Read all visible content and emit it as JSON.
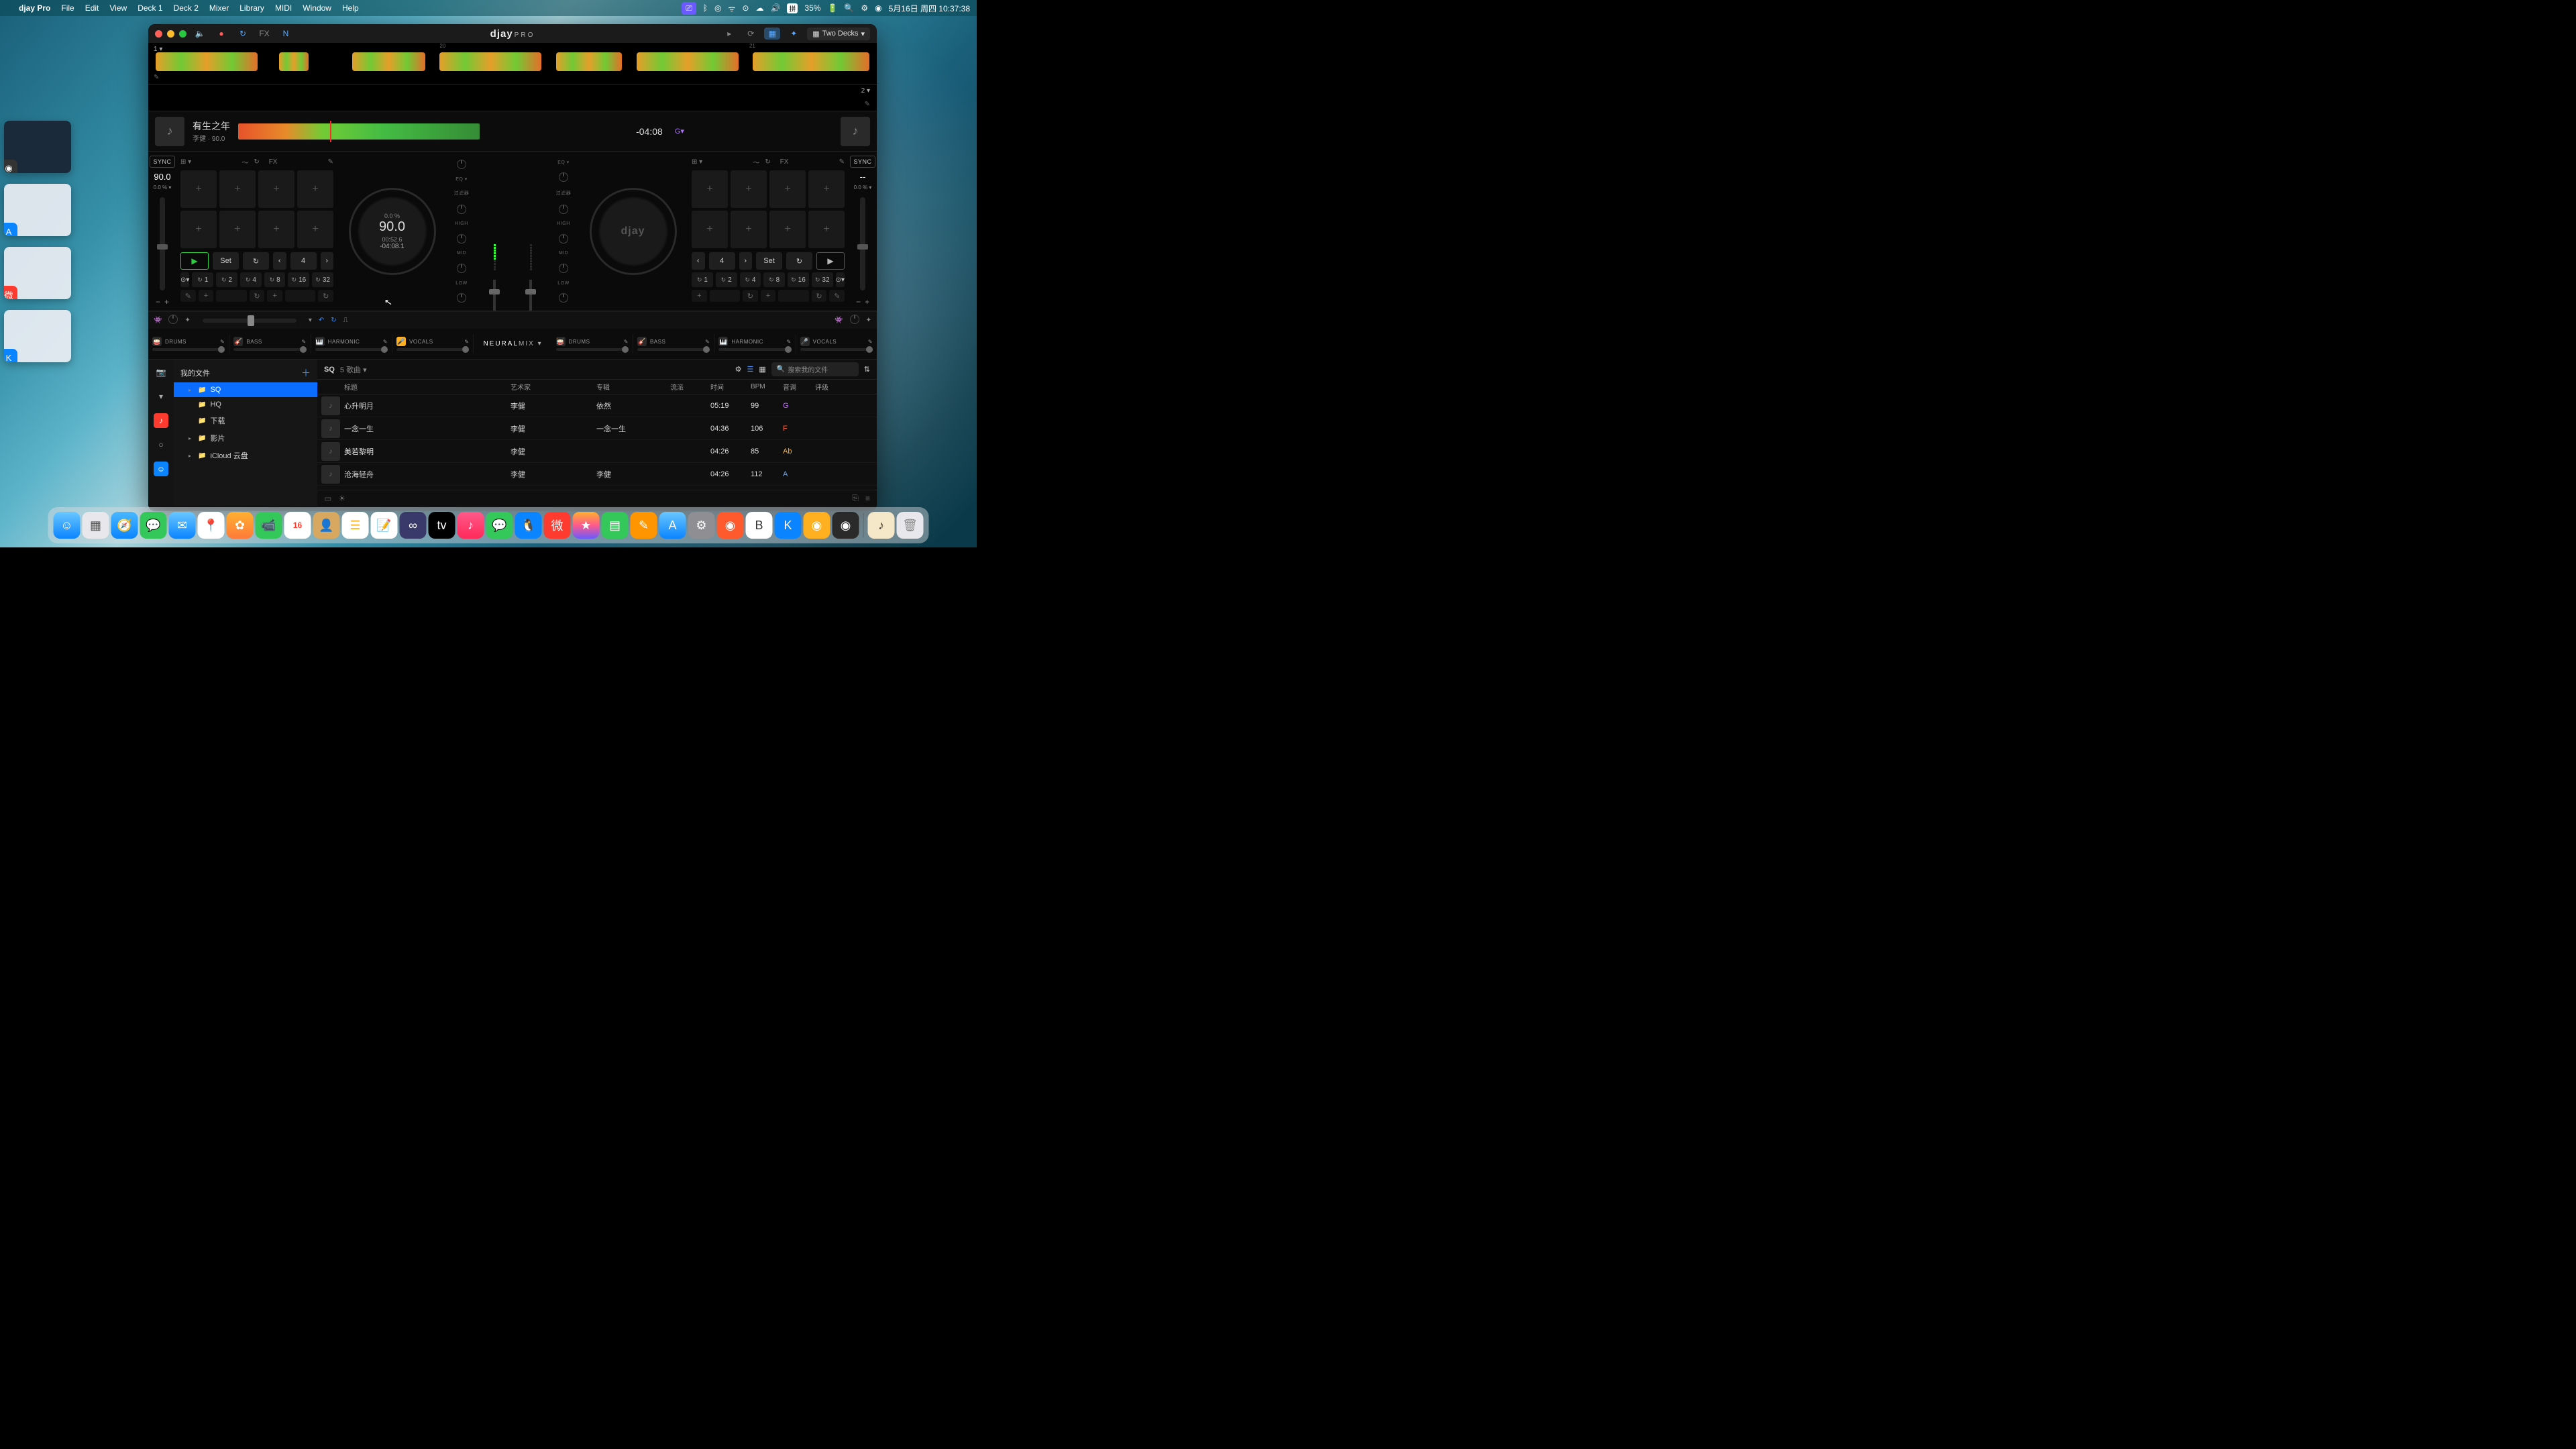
{
  "menubar": {
    "app": "djay Pro",
    "items": [
      "File",
      "Edit",
      "View",
      "Deck 1",
      "Deck 2",
      "Mixer",
      "Library",
      "MIDI",
      "Window",
      "Help"
    ],
    "battery": "35%",
    "ime": "拼",
    "datetime": "5月16日 周四  10:37:38"
  },
  "titlebar": {
    "logo_main": "djay",
    "logo_sub": "PRO",
    "deck_mode": "Two Decks"
  },
  "overview": {
    "deck1_num": "1 ▾",
    "tick20": "20",
    "tick21": "21",
    "deck2_num": "2 ▾"
  },
  "deck1": {
    "title": "有生之年",
    "subtitle": "李健 · 90.0",
    "remain": "-04:08",
    "key": "G▾",
    "sync": "SYNC",
    "bpm": "90.0",
    "bpm_pct": "0.0 % ▾",
    "jog_pct": "0.0 %",
    "jog_bpm": "90.0",
    "jog_elapsed": "00:52.6",
    "jog_remain": "-04:08.1",
    "set": "Set",
    "beat": "4",
    "fx_label": "FX",
    "loops": [
      "1",
      "2",
      "4",
      "8",
      "16",
      "32"
    ]
  },
  "deck2": {
    "sync": "SYNC",
    "bpm": "--",
    "bpm_pct": "0.0 % ▾",
    "jog_brand": "djay",
    "set": "Set",
    "beat": "4",
    "fx_label": "FX",
    "loops": [
      "1",
      "2",
      "4",
      "8",
      "16",
      "32"
    ]
  },
  "eq": {
    "filter": "过滤器",
    "high": "HIGH",
    "mid": "MID",
    "low": "LOW",
    "eq": "EQ ▾"
  },
  "neural": {
    "stems": [
      "DRUMS",
      "BASS",
      "HARMONIC",
      "VOCALS"
    ],
    "label_a": "NEURAL",
    "label_b": "MIX ▾"
  },
  "library": {
    "header": "我的文件",
    "playlist_name": "SQ",
    "count": "5 歌曲 ▾",
    "search_ph": "搜索我的文件",
    "folders": [
      "SQ",
      "HQ",
      "下载",
      "影片",
      "iCloud 云盘"
    ],
    "cols": [
      "标题",
      "艺术家",
      "专辑",
      "流派",
      "时间",
      "BPM",
      "音调",
      "评级"
    ],
    "rows": [
      {
        "title": "心升明月",
        "artist": "李健",
        "album": "依然",
        "time": "05:19",
        "bpm": "99",
        "key": "G",
        "kc": "k-g"
      },
      {
        "title": "一念一生",
        "artist": "李健",
        "album": "一念一生",
        "time": "04:36",
        "bpm": "106",
        "key": "F",
        "kc": "k-f"
      },
      {
        "title": "美若黎明",
        "artist": "李健",
        "album": "",
        "time": "04:26",
        "bpm": "85",
        "key": "Ab",
        "kc": "k-ab"
      },
      {
        "title": "沧海轻舟",
        "artist": "李健",
        "album": "李健",
        "time": "04:26",
        "bpm": "112",
        "key": "A",
        "kc": "k-a"
      }
    ]
  }
}
